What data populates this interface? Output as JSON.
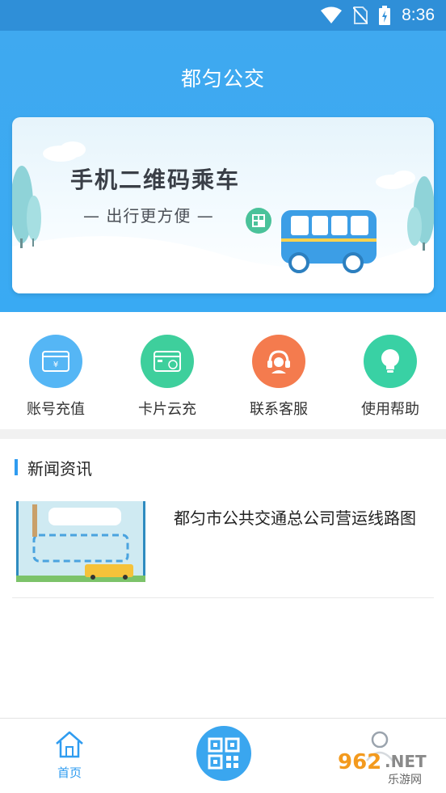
{
  "status_bar": {
    "time": "8:36",
    "icons": [
      "wifi-icon",
      "no-sim-icon",
      "battery-charging-icon"
    ]
  },
  "header": {
    "title": "都匀公交"
  },
  "banner": {
    "title": "手机二维码乘车",
    "subtitle": "— 出行更方便 —"
  },
  "quick_actions": [
    {
      "label": "账号充值",
      "icon": "recharge-card-icon",
      "color": "#55b6f5"
    },
    {
      "label": "卡片云充",
      "icon": "cloud-card-icon",
      "color": "#3ecf9c"
    },
    {
      "label": "联系客服",
      "icon": "customer-service-icon",
      "color": "#f47b4e"
    },
    {
      "label": "使用帮助",
      "icon": "lightbulb-icon",
      "color": "#39d1a4"
    }
  ],
  "news": {
    "section_title": "新闻资讯",
    "items": [
      {
        "title": "都匀市公共交通总公司营运线路图"
      }
    ]
  },
  "bottom_nav": {
    "home_label": "首页",
    "icons": [
      "home-icon",
      "qr-code-icon",
      "user-icon"
    ]
  },
  "watermark": {
    "text": "962.NET",
    "sub": "乐游网"
  },
  "colors": {
    "primary": "#39aaf3",
    "status_bar": "#2f8fd8"
  }
}
